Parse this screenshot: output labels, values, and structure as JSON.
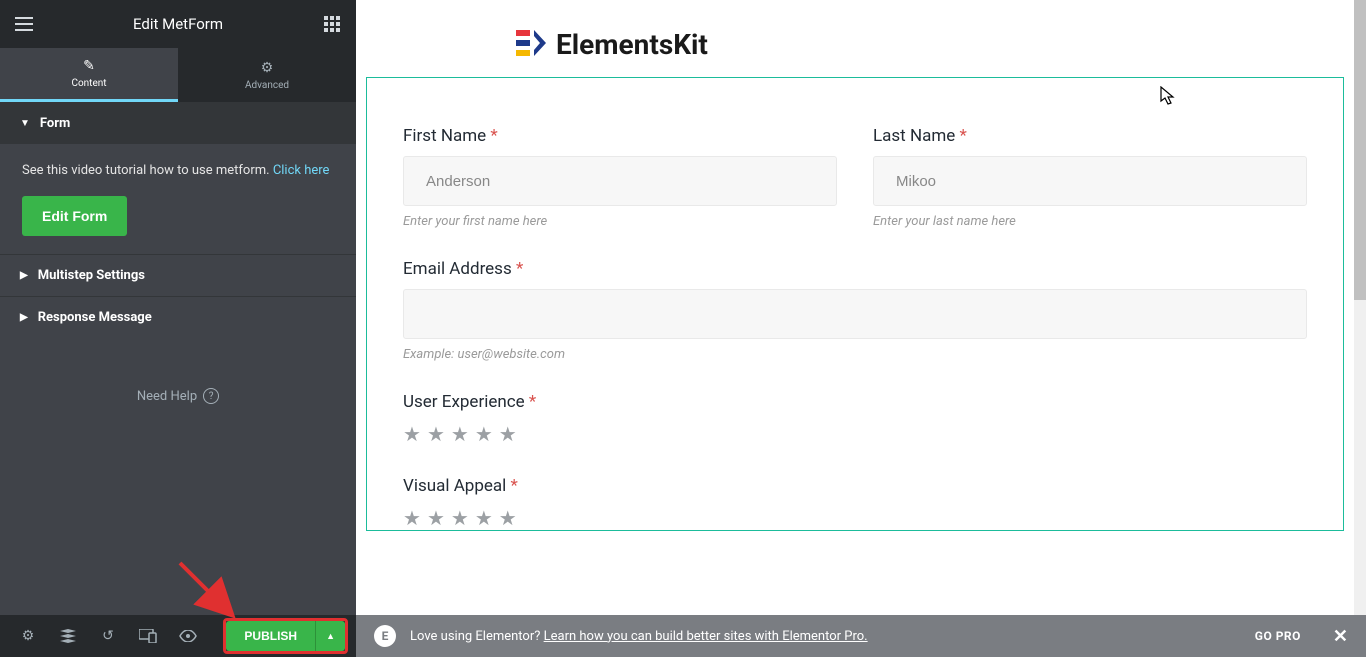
{
  "header": {
    "title": "Edit MetForm"
  },
  "tabs": {
    "content": "Content",
    "advanced": "Advanced"
  },
  "sections": {
    "form": "Form",
    "multistep": "Multistep Settings",
    "response": "Response Message"
  },
  "form_panel": {
    "tutorial_text": "See this video tutorial how to use metform. ",
    "tutorial_link": "Click here",
    "edit_button": "Edit Form"
  },
  "need_help": "Need Help",
  "bottom": {
    "publish": "PUBLISH"
  },
  "logo": {
    "text": "ElementsKit"
  },
  "fields": {
    "first_name": {
      "label": "First Name",
      "placeholder": "Anderson",
      "hint": "Enter your first name here"
    },
    "last_name": {
      "label": "Last Name",
      "placeholder": "Mikoo",
      "hint": "Enter your last name here"
    },
    "email": {
      "label": "Email Address",
      "hint": "Example: user@website.com"
    },
    "ux": {
      "label": "User Experience"
    },
    "visual": {
      "label": "Visual Appeal"
    }
  },
  "footer": {
    "text": "Love using Elementor? ",
    "link": "Learn how you can build better sites with Elementor Pro.",
    "go_pro": "GO PRO"
  },
  "req": "*"
}
